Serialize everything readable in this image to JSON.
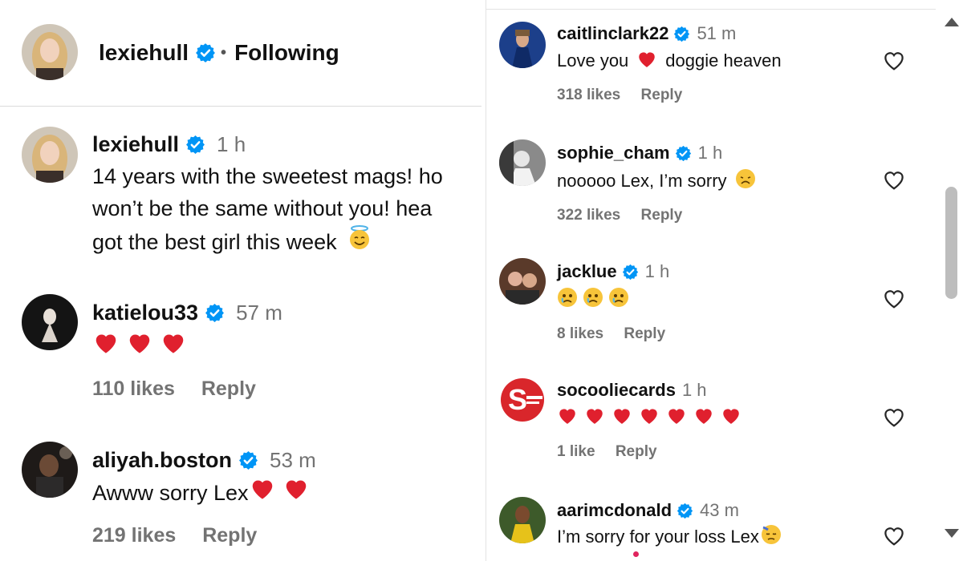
{
  "header": {
    "username": "lexiehull",
    "separator": "•",
    "follow_label": "Following"
  },
  "post": {
    "username": "lexiehull",
    "time": "1 h",
    "lines": [
      "14 years with the sweetest mags! ho",
      "won’t be the same without you! hea",
      "got the best girl this week"
    ],
    "emoji": "angel-face"
  },
  "left_comments": [
    {
      "username": "katielou33",
      "time": "57 m",
      "hearts": 3,
      "text": "",
      "likes": "110 likes",
      "reply": "Reply"
    },
    {
      "username": "aliyah.boston",
      "time": "53 m",
      "hearts": 2,
      "text": "Awww sorry Lex",
      "likes": "219 likes",
      "reply": "Reply"
    }
  ],
  "right_comments": [
    {
      "username": "caitlinclark22",
      "time": "51 m",
      "text_before": "Love you",
      "text_after": "doggie heaven",
      "likes": "318 likes",
      "reply": "Reply"
    },
    {
      "username": "sophie_cham",
      "time": "1 h",
      "text": "nooooo Lex, I’m sorry",
      "likes": "322 likes",
      "reply": "Reply"
    },
    {
      "username": "jacklue",
      "time": "1 h",
      "crying_faces": 3,
      "likes": "8 likes",
      "reply": "Reply"
    },
    {
      "username": "socooliecards",
      "time": "1 h",
      "hearts": 7,
      "likes": "1 like",
      "reply": "Reply"
    },
    {
      "username": "aarimcdonald",
      "time": "43 m",
      "text": "I’m sorry for your loss Lex"
    }
  ],
  "colors": {
    "verified": "#0095f6",
    "heart": "#e0202e",
    "muted": "#737373"
  }
}
